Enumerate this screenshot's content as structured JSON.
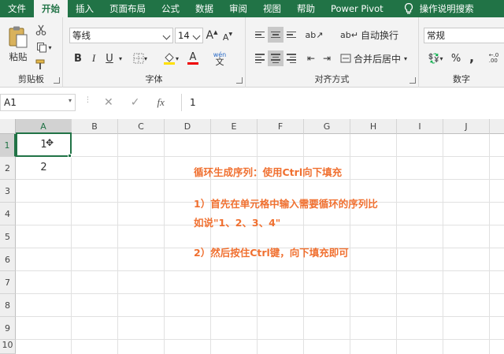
{
  "tabs": [
    "文件",
    "开始",
    "插入",
    "页面布局",
    "公式",
    "数据",
    "审阅",
    "视图",
    "帮助",
    "Power Pivot"
  ],
  "active_tab": "开始",
  "search_label": "操作说明搜索",
  "ribbon": {
    "clipboard": {
      "label": "剪贴板",
      "paste_label": "粘贴"
    },
    "font": {
      "label": "字体",
      "font_name": "等线",
      "font_size": "14",
      "bold": "B",
      "italic": "I",
      "underline": "U",
      "grow": "A",
      "shrink": "A",
      "color_letter": "A",
      "wen": "wén"
    },
    "alignment": {
      "label": "对齐方式",
      "wrap_text": "自动换行",
      "merge_center": "合并后居中"
    },
    "number": {
      "label": "数字",
      "format": "常规",
      "percent": "%",
      "comma": ","
    }
  },
  "formula_bar": {
    "name_box": "A1",
    "fx": "fx",
    "value": "1"
  },
  "columns": [
    "A",
    "B",
    "C",
    "D",
    "E",
    "F",
    "G",
    "H",
    "I",
    "J"
  ],
  "rows": [
    "1",
    "2",
    "3",
    "4",
    "5",
    "6",
    "7",
    "8",
    "9",
    "10"
  ],
  "cells": {
    "A1": "1",
    "A2": "2"
  },
  "notes": {
    "line1": "循环生成序列：使用Ctrl向下填充",
    "line2": "1）首先在单元格中输入需要循环的序列比",
    "line3": "如说\"1、2、3、4\"",
    "line4": "2）然后按住Ctrl键，向下填充即可"
  },
  "accent_color": "#217346",
  "note_color": "#f07030"
}
